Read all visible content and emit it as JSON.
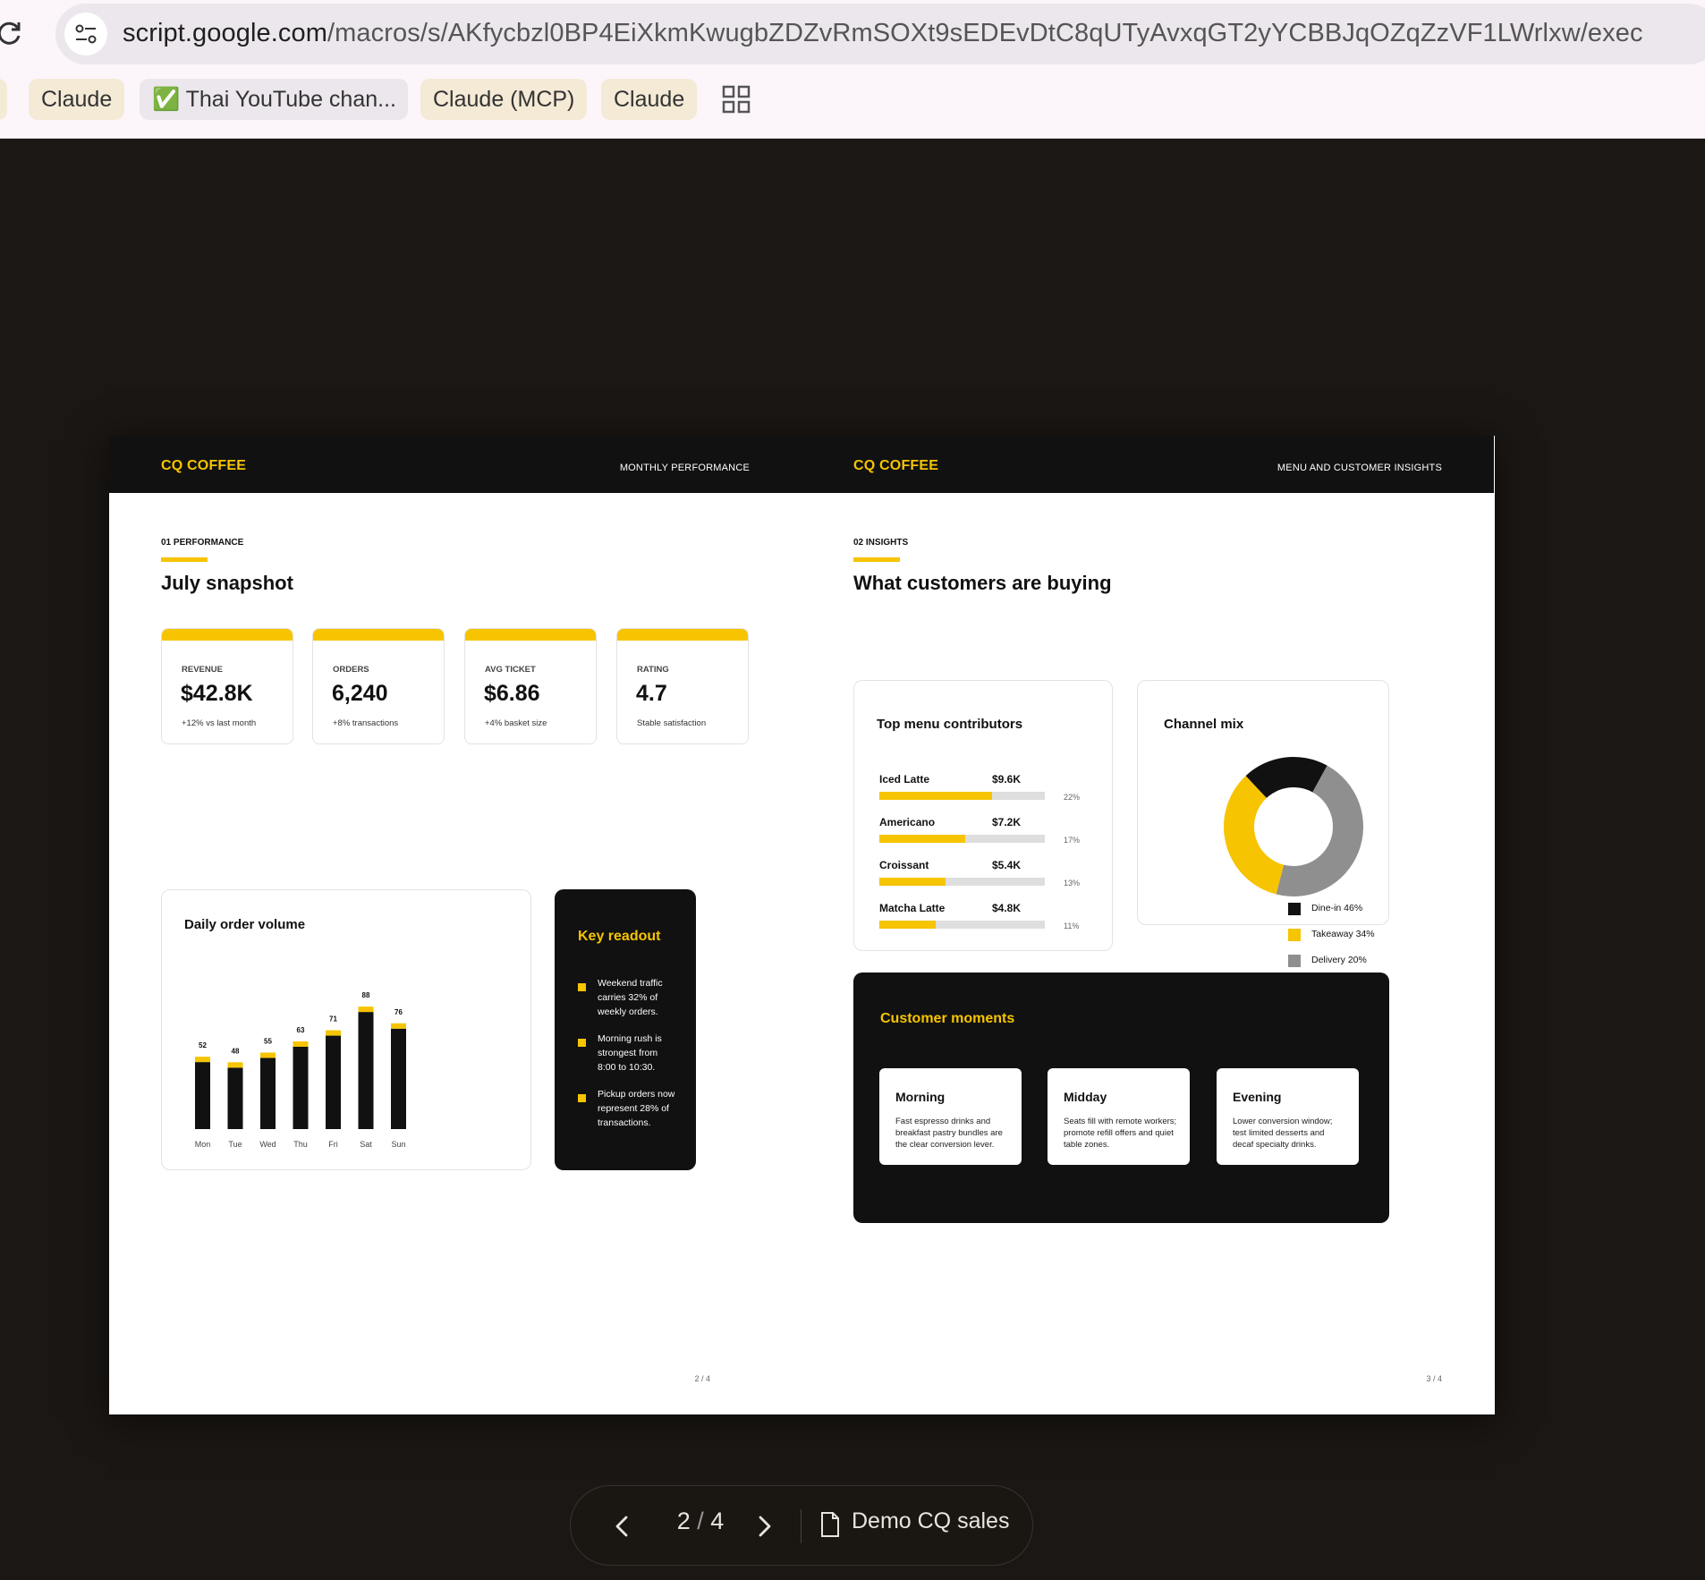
{
  "browser": {
    "url_host": "script.google.com",
    "url_path": "/macros/s/AKfycbzl0BP4EiXkmKwugbZDZvRmSOXt9sEDEvDtC8qUTyAvxqGT2yYCBBJqOZqZzVF1LWrlxw/exec",
    "bookmarks": [
      {
        "label": "Claude"
      },
      {
        "label": "✅ Thai YouTube chan..."
      },
      {
        "label": "Claude (MCP)"
      },
      {
        "label": "Claude"
      }
    ]
  },
  "slide_left": {
    "brand": "CQ COFFEE",
    "header_title": "MONTHLY PERFORMANCE",
    "eyebrow": "01 PERFORMANCE",
    "heading": "July snapshot",
    "kpis": [
      {
        "label": "REVENUE",
        "value": "$42.8K",
        "note": "+12% vs last month"
      },
      {
        "label": "ORDERS",
        "value": "6,240",
        "note": "+8% transactions"
      },
      {
        "label": "AVG TICKET",
        "value": "$6.86",
        "note": "+4% basket size"
      },
      {
        "label": "RATING",
        "value": "4.7",
        "note": "Stable satisfaction"
      }
    ],
    "orders_card_title": "Daily order volume",
    "readout_title": "Key readout",
    "readout_items": [
      "Weekend traffic carries 32% of weekly orders.",
      "Morning rush is strongest from 8:00 to 10:30.",
      "Pickup orders now represent 28% of transactions."
    ],
    "page_number": "2 / 4"
  },
  "slide_right": {
    "brand": "CQ COFFEE",
    "header_title": "MENU AND CUSTOMER INSIGHTS",
    "eyebrow": "02 INSIGHTS",
    "heading": "What customers are buying",
    "menu_card_title": "Top menu contributors",
    "menu_items": [
      {
        "name": "Iced Latte",
        "value": "$9.6K",
        "pct_label": "22%",
        "pct": 0.68
      },
      {
        "name": "Americano",
        "value": "$7.2K",
        "pct_label": "17%",
        "pct": 0.52
      },
      {
        "name": "Croissant",
        "value": "$5.4K",
        "pct_label": "13%",
        "pct": 0.4
      },
      {
        "name": "Matcha Latte",
        "value": "$4.8K",
        "pct_label": "11%",
        "pct": 0.34
      }
    ],
    "channel_card_title": "Channel mix",
    "moments_title": "Customer moments",
    "moments": [
      {
        "title": "Morning",
        "text": "Fast espresso drinks and breakfast pastry bundles are the clear conversion lever."
      },
      {
        "title": "Midday",
        "text": "Seats fill with remote workers; promote refill offers and quiet table zones."
      },
      {
        "title": "Evening",
        "text": "Lower conversion window; test limited desserts and decaf specialty drinks."
      }
    ],
    "page_number": "3 / 4"
  },
  "chart_data": [
    {
      "type": "bar",
      "title": "Daily order volume",
      "categories": [
        "Mon",
        "Tue",
        "Wed",
        "Thu",
        "Fri",
        "Sat",
        "Sun"
      ],
      "values": [
        52,
        48,
        55,
        63,
        71,
        88,
        76
      ],
      "colors": {
        "bar": "#111111",
        "cap": "#f6c400"
      }
    },
    {
      "type": "pie",
      "title": "Channel mix",
      "categories": [
        "Dine-in 46%",
        "Takeaway 34%",
        "Delivery 20%"
      ],
      "values": [
        46,
        34,
        20
      ],
      "colors": [
        "#111111",
        "#f6c400",
        "#8f8f8f"
      ]
    }
  ],
  "toolbar": {
    "current_page": "2",
    "separator": "/",
    "total_pages": "4",
    "doc_name": "Demo CQ sales"
  },
  "colors": {
    "accent": "#f6c400",
    "dark": "#111111",
    "backdrop": "#1b1714"
  }
}
